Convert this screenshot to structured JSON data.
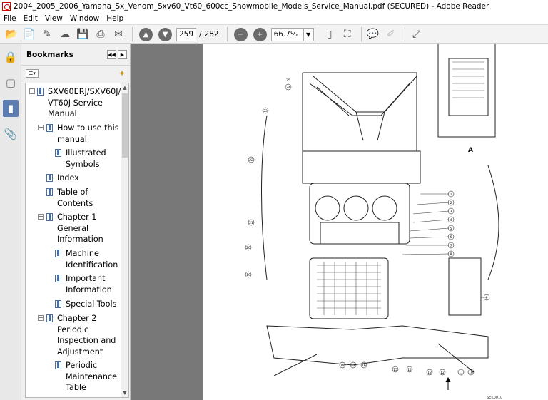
{
  "window": {
    "title": "2004_2005_2006_Yamaha_Sx_Venom_Sxv60_Vt60_600cc_Snowmobile_Models_Service_Manual.pdf (SECURED) - Adobe Reader"
  },
  "menu": [
    "File",
    "Edit",
    "View",
    "Window",
    "Help"
  ],
  "toolbar": {
    "page_current": "259",
    "page_separator": "/",
    "page_total": "282",
    "zoom": "66.7%"
  },
  "bookmarks": {
    "header": "Bookmarks",
    "items": [
      {
        "line1": "SXV60ERJ/SXV60J/",
        "line2": "VT60J Service",
        "line3": "Manual"
      },
      {
        "line1": "How to use this",
        "line2": "manual"
      },
      {
        "line1": "Illustrated",
        "line2": "Symbols"
      },
      {
        "line1": "Index"
      },
      {
        "line1": "Table of",
        "line2": "Contents"
      },
      {
        "line1": "Chapter 1",
        "line2": "General",
        "line3": "Information"
      },
      {
        "line1": "Machine",
        "line2": "Identification"
      },
      {
        "line1": "Important",
        "line2": "Information"
      },
      {
        "line1": "Special Tools"
      },
      {
        "line1": "Chapter 2",
        "line2": "Periodic",
        "line3": "Inspection and",
        "line4": "Adjustment"
      },
      {
        "line1": "Periodic",
        "line2": "Maintenance",
        "line3": "Table"
      }
    ]
  },
  "page": {
    "view_label": "A",
    "caption": "SEK0010",
    "callouts": [
      "1",
      "2",
      "3",
      "4",
      "5",
      "6",
      "7",
      "8",
      "9",
      "10",
      "11",
      "12",
      "13",
      "14",
      "15",
      "16",
      "17",
      "18",
      "19",
      "20",
      "21",
      "22",
      "23",
      "24",
      "25"
    ]
  },
  "colors": {
    "workarea": "#787878",
    "panel": "#f0f0f0",
    "toolbar": "#f3f3f3",
    "active_tab": "#5b7db2"
  }
}
